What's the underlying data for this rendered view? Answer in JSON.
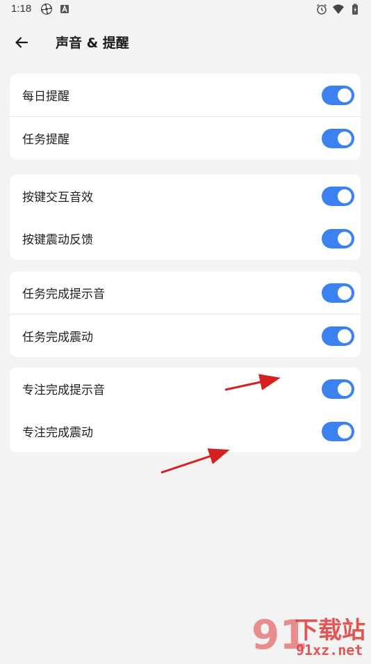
{
  "status_bar": {
    "time": "1:18",
    "left_icons": [
      "pinwheel-icon",
      "app-a-icon"
    ],
    "right_icons": [
      "alarm-icon",
      "wifi-icon",
      "battery-icon"
    ]
  },
  "app_bar": {
    "title": "声音 & 提醒"
  },
  "groups": [
    {
      "rows": [
        {
          "label": "每日提醒",
          "enabled": true
        },
        {
          "label": "任务提醒",
          "enabled": true
        }
      ]
    },
    {
      "rows": [
        {
          "label": "按键交互音效",
          "enabled": true
        },
        {
          "label": "按键震动反馈",
          "enabled": true
        }
      ]
    },
    {
      "rows": [
        {
          "label": "任务完成提示音",
          "enabled": true
        },
        {
          "label": "任务完成震动",
          "enabled": true
        }
      ]
    },
    {
      "rows": [
        {
          "label": "专注完成提示音",
          "enabled": true
        },
        {
          "label": "专注完成震动",
          "enabled": true
        }
      ]
    }
  ],
  "watermark": {
    "brand_text": "下载站",
    "domain_text": "91xz.net"
  },
  "colors": {
    "accent": "#3b82f0",
    "background": "#f3f3f3",
    "card": "#ffffff",
    "annotation_arrow": "#d42020",
    "watermark": "#e03a3a"
  }
}
